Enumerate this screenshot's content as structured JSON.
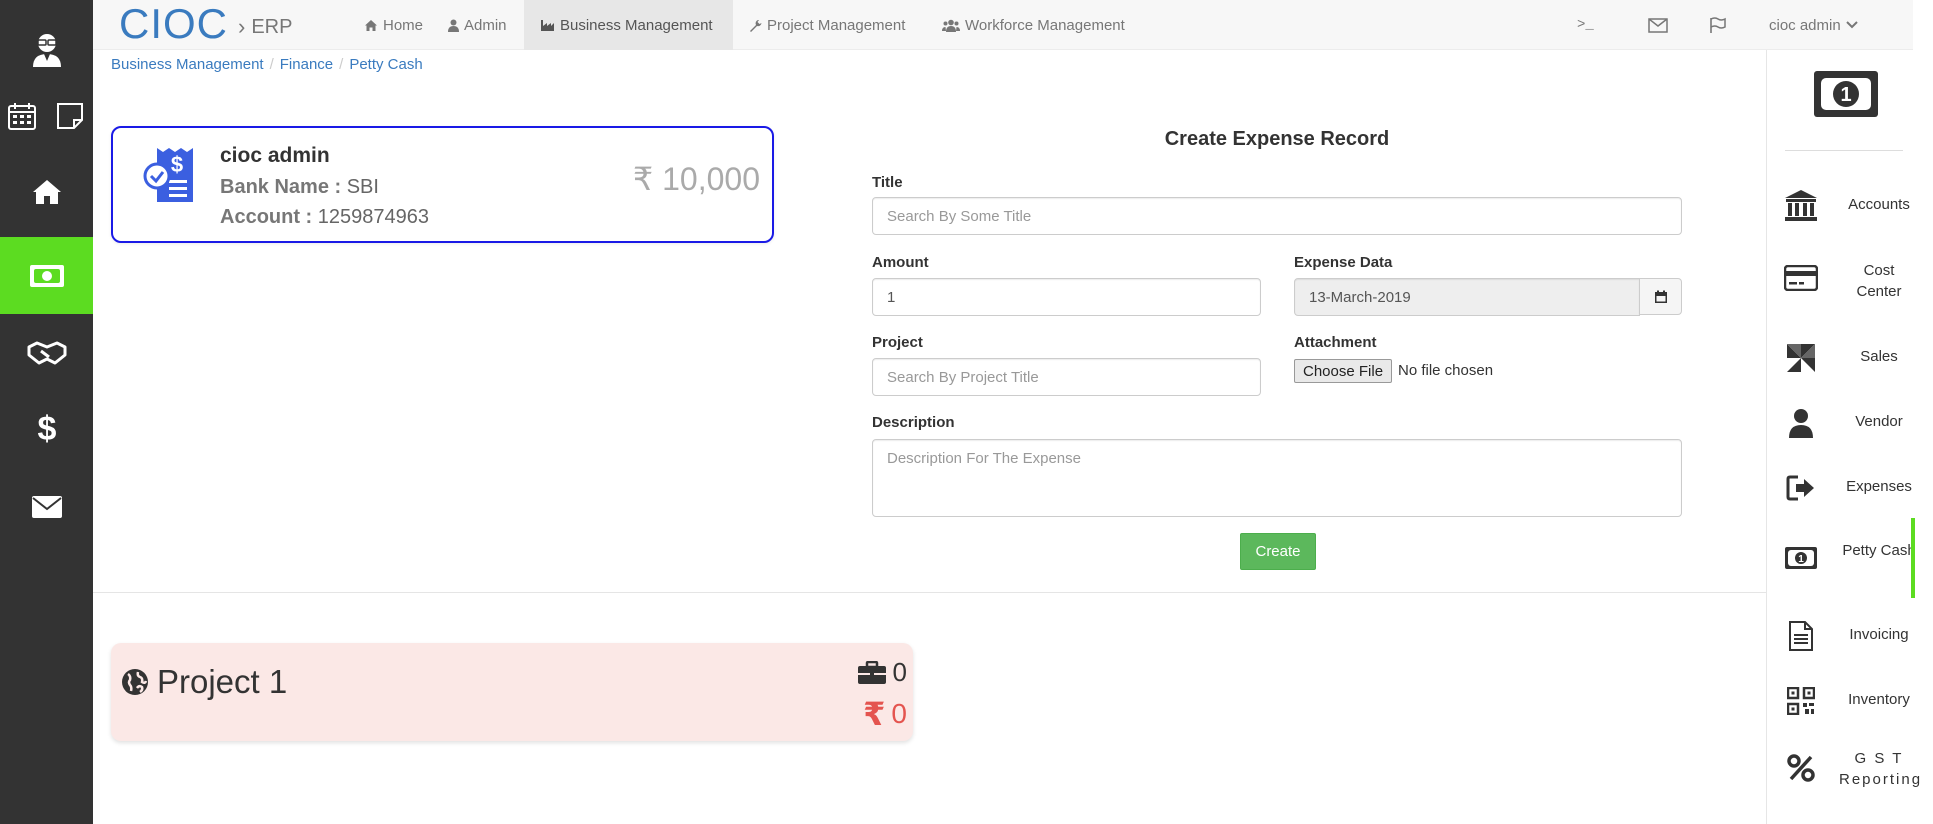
{
  "topnav": {
    "brand": "CIOC",
    "brand_sep": "›",
    "brand_sub": "ERP",
    "links": [
      {
        "label": "Home",
        "icon": "home-icon"
      },
      {
        "label": "Admin",
        "icon": "user-icon"
      },
      {
        "label": "Business Management",
        "icon": "industry-icon",
        "active": true
      },
      {
        "label": "Project Management",
        "icon": "wrench-icon"
      },
      {
        "label": "Workforce Management",
        "icon": "users-icon"
      }
    ],
    "terminal_glyph": ">_",
    "user": "cioc admin"
  },
  "breadcrumb": [
    "Business Management",
    "Finance",
    "Petty Cash"
  ],
  "account": {
    "name": "cioc admin",
    "bank_label": "Bank Name :",
    "bank": "SBI",
    "account_label": "Account :",
    "account_number": "1259874963",
    "balance": "₹ 10,000"
  },
  "form": {
    "title": "Create Expense Record",
    "title_label": "Title",
    "title_placeholder": "Search By Some Title",
    "amount_label": "Amount",
    "amount_value": "1",
    "date_label": "Expense Data",
    "date_value": "13-March-2019",
    "project_label": "Project",
    "project_placeholder": "Search By Project Title",
    "attachment_label": "Attachment",
    "file_button": "Choose File",
    "file_status": "No file chosen",
    "description_label": "Description",
    "description_placeholder": "Description For The Expense",
    "create_label": "Create"
  },
  "project": {
    "title": "Project 1",
    "count": "0",
    "amount": "0",
    "currency": "₹"
  },
  "rightbar": {
    "items": [
      {
        "label": "Accounts",
        "icon": "bank-icon"
      },
      {
        "label": "Cost Center",
        "icon": "credit-card-icon"
      },
      {
        "label": "Sales",
        "icon": "pinwheel-icon"
      },
      {
        "label": "Vendor",
        "icon": "user-icon"
      },
      {
        "label": "Expenses",
        "icon": "sign-out-icon"
      },
      {
        "label": "Petty Cash",
        "icon": "money-icon"
      },
      {
        "label": "Invoicing",
        "icon": "file-text-icon"
      },
      {
        "label": "Inventory",
        "icon": "qrcode-icon"
      },
      {
        "label": "G S T Reporting",
        "icon": "percent-icon"
      }
    ]
  },
  "colors": {
    "accent_green": "#5cdc21",
    "sidebar_dark": "#333333",
    "brand_blue": "#3a7bbf",
    "card_border": "#1a1ae6",
    "project_bg": "#fbe8e6",
    "danger": "#e4544f",
    "button_green": "#5cb85c"
  }
}
